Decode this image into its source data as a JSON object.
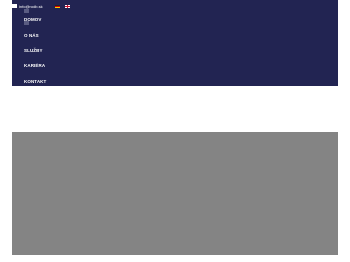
{
  "topbar": {
    "email": "info@rodb.sk",
    "mail_icon": "envelope-icon",
    "languages": [
      {
        "code": "de",
        "icon": "flag-de-icon"
      },
      {
        "code": "en",
        "icon": "flag-en-icon"
      }
    ]
  },
  "menu": {
    "toggle_icon": "hamburger-icon",
    "items": [
      {
        "label": "DOMOV"
      },
      {
        "label": "O NÁS"
      },
      {
        "label": "SLUŽBY"
      },
      {
        "label": "KARIÉRA"
      },
      {
        "label": "KONTAKT"
      }
    ]
  },
  "colors": {
    "navbar": "#222452",
    "hero_placeholder": "#848484"
  }
}
